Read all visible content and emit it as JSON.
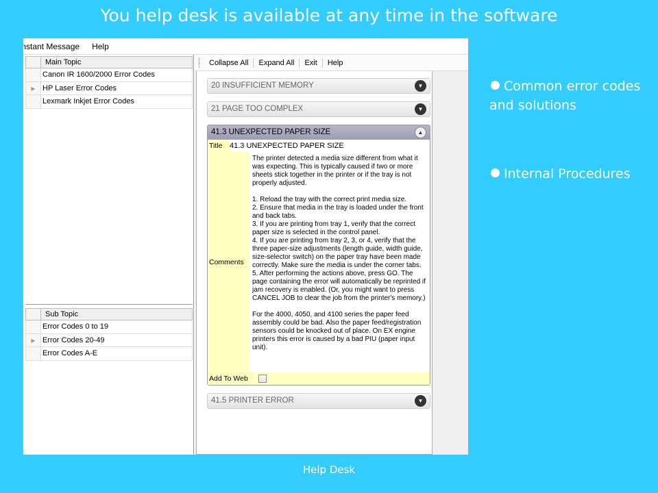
{
  "slide": {
    "title": "You help desk is available at any time in the software",
    "bullets": [
      "Common error codes and solutions",
      "Internal Procedures"
    ],
    "caption": "Help Desk"
  },
  "menubar": {
    "items": [
      "Instant Message",
      "Help"
    ]
  },
  "main_topic_grid": {
    "header": "Main Topic",
    "rows": [
      "Canon IR 1600/2000 Error Codes",
      "HP Laser Error Codes",
      "Lexmark Inkjet Error Codes"
    ],
    "selected_index": 1
  },
  "sub_topic_grid": {
    "header": "Sub Topic",
    "rows": [
      "Error Codes 0 to 19",
      "Error Codes 20-49",
      "Error Codes A-E"
    ],
    "selected_index": 1
  },
  "toolbar": {
    "collapse_all": "Collapse All",
    "expand_all": "Expand All",
    "exit": "Exit",
    "help": "Help"
  },
  "groups": [
    {
      "title": "20 INSUFFICIENT MEMORY",
      "expanded": false
    },
    {
      "title": "21 PAGE TOO COMPLEX",
      "expanded": false
    },
    {
      "title": "41.3 UNEXPECTED PAPER SIZE",
      "expanded": true
    },
    {
      "title": "41.5 PRINTER ERROR",
      "expanded": false
    }
  ],
  "detail": {
    "title_label": "Title",
    "title_value": "41.3 UNEXPECTED PAPER SIZE",
    "comments_label": "Comments",
    "comments_text": "The printer detected a media size different from what it was expecting. This is typically caused if two or more sheets stick together in the printer or if the tray is not properly adjusted.\n\n1. Reload the tray with the correct print media size.\n2. Ensure that media in the tray is loaded under the front and back tabs.\n3. If you are printing from tray 1, verify that the correct paper size is selected in the control panel.\n4. If you are printing from tray 2, 3, or 4, verify that the three paper-size adjustments (length guide, width guide, size-selector switch) on the paper tray have been made correctly. Make sure the media is under the corner tabs.\n5. After performing the actions above, press GO. The page containing the error will automatically be reprinted if jam recovery is enabled. (Or, you might want to press CANCEL JOB to clear the job from the printer's memory.)\n\nFor the 4000, 4050, and 4100 series the paper feed assembly could be bad. Also the paper feed/registration sensors could be knocked out of place. On EX engine printers this error is caused by a bad PIU (paper input unit).",
    "add_to_web_label": "Add To Web",
    "add_to_web_checked": false
  }
}
